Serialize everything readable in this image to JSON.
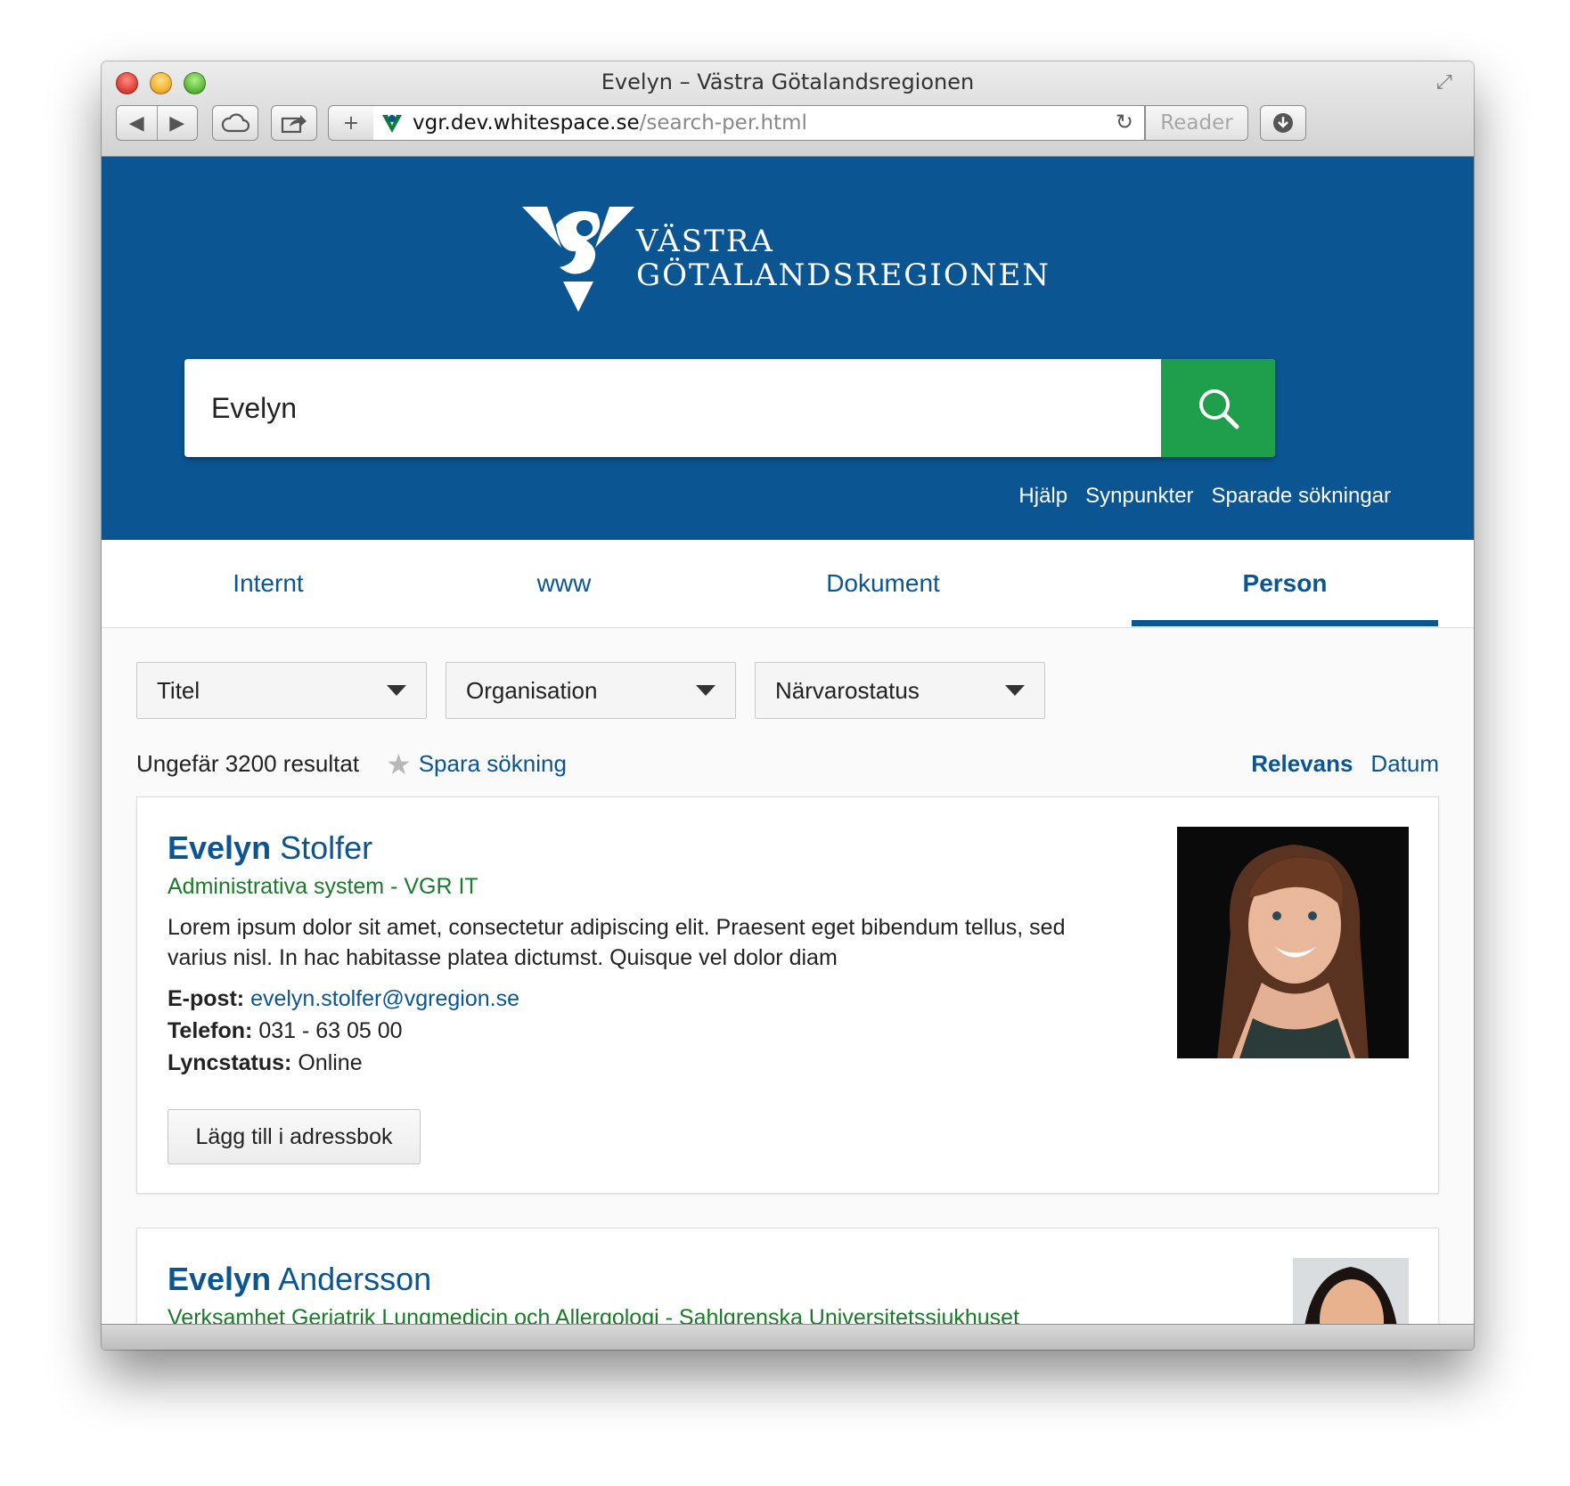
{
  "window": {
    "title": "Evelyn – Västra Götalandsregionen"
  },
  "toolbar": {
    "back_icon": "◀",
    "forward_icon": "▶",
    "add_icon": "+",
    "url_host": "vgr.dev.whitespace.se",
    "url_path": "/search-per.html",
    "reader_label": "Reader"
  },
  "logo": {
    "line1": "VÄSTRA",
    "line2": "GÖTALANDSREGIONEN"
  },
  "search": {
    "value": "Evelyn"
  },
  "header_links": [
    "Hjälp",
    "Synpunkter",
    "Sparade sökningar"
  ],
  "tabs": [
    {
      "label": "Internt"
    },
    {
      "label": "www"
    },
    {
      "label": "Dokument"
    },
    {
      "label": "Person",
      "active": true
    }
  ],
  "filters": [
    {
      "label": "Titel"
    },
    {
      "label": "Organisation"
    },
    {
      "label": "Närvarostatus"
    }
  ],
  "results_meta": {
    "count": "Ungefär 3200 resultat",
    "save_search": "Spara sökning",
    "sort_relevance": "Relevans",
    "sort_date": "Datum"
  },
  "results": [
    {
      "first": "Evelyn",
      "last": " Stolfer",
      "org": "Administrativa system - VGR IT",
      "desc": "Lorem ipsum dolor sit amet, consectetur adipiscing elit. Praesent eget bibendum tellus, sed varius nisl. In hac habitasse platea dictumst. Quisque vel dolor diam",
      "email_label": "E-post:",
      "email": "evelyn.stolfer@vgregion.se",
      "phone_label": "Telefon:",
      "phone": "031 - 63 05 00",
      "lync_label": "Lyncstatus:",
      "lync": "Online",
      "add_button": "Lägg till i adressbok"
    },
    {
      "first": "Evelyn",
      "last": " Andersson",
      "org": "Verksamhet Geriatrik Lungmedicin och Allergologi - Sahlgrenska Universitetssjukhuset"
    }
  ],
  "colors": {
    "brand_blue": "#0b5592",
    "search_green": "#1f9e4b",
    "org_green": "#1a7a2a"
  }
}
